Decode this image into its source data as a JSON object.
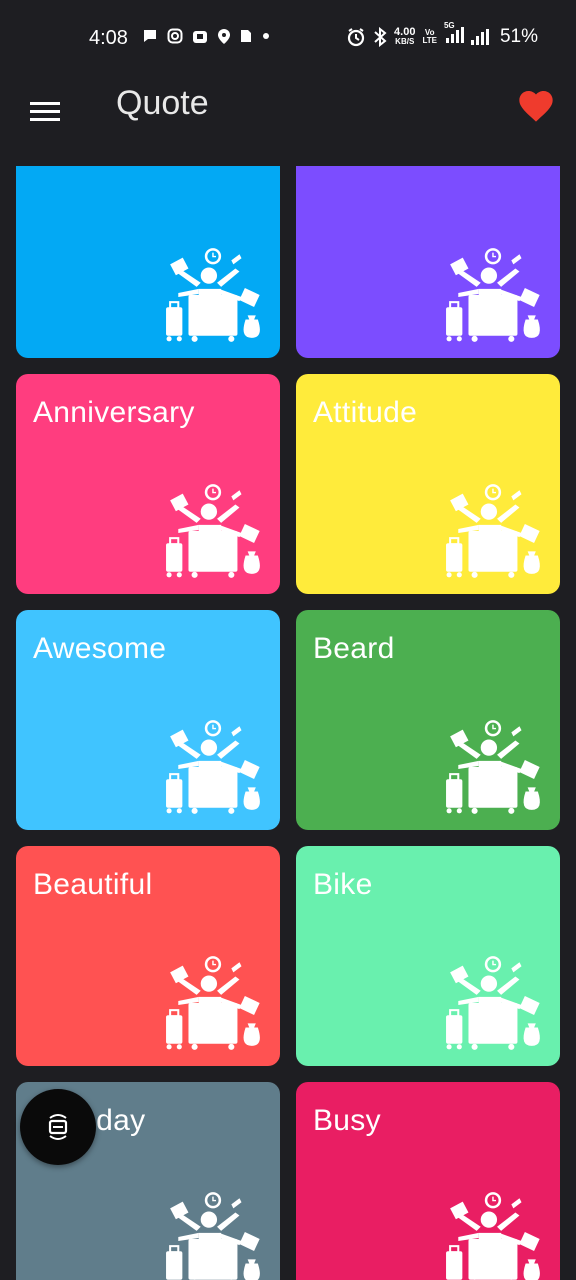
{
  "status_bar": {
    "time": "4:08",
    "net_speed": "4.00",
    "net_speed_unit": "KB/S",
    "volte_top": "Vo",
    "volte_bottom": "LTE",
    "network": "5G",
    "battery": "51%",
    "icons": [
      "messages-icon",
      "instagram-icon",
      "shop-icon",
      "location-icon",
      "sim-icon",
      "dot-icon",
      "alarm-icon",
      "bluetooth-icon",
      "signal-icon",
      "signal-icon"
    ]
  },
  "app_bar": {
    "title": "Quote",
    "menu_icon": "menu-icon",
    "fav_icon": "heart-icon",
    "accent": "#ef3b2d"
  },
  "categories": [
    {
      "label": "",
      "color": "#03a9f4"
    },
    {
      "label": "",
      "color": "#7c4dff"
    },
    {
      "label": "Anniversary",
      "color": "#ff3d7f"
    },
    {
      "label": "Attitude",
      "color": "#ffeb3b"
    },
    {
      "label": "Awesome",
      "color": "#40c4ff"
    },
    {
      "label": "Beard",
      "color": "#4caf50"
    },
    {
      "label": "Beautiful",
      "color": "#ff5252"
    },
    {
      "label": "Bike",
      "color": "#69f0ae"
    },
    {
      "label": "Birthday",
      "color": "#607d8b"
    },
    {
      "label": "Busy",
      "color": "#e91e63"
    }
  ],
  "fab": {
    "icon": "screen-rotate-icon"
  }
}
